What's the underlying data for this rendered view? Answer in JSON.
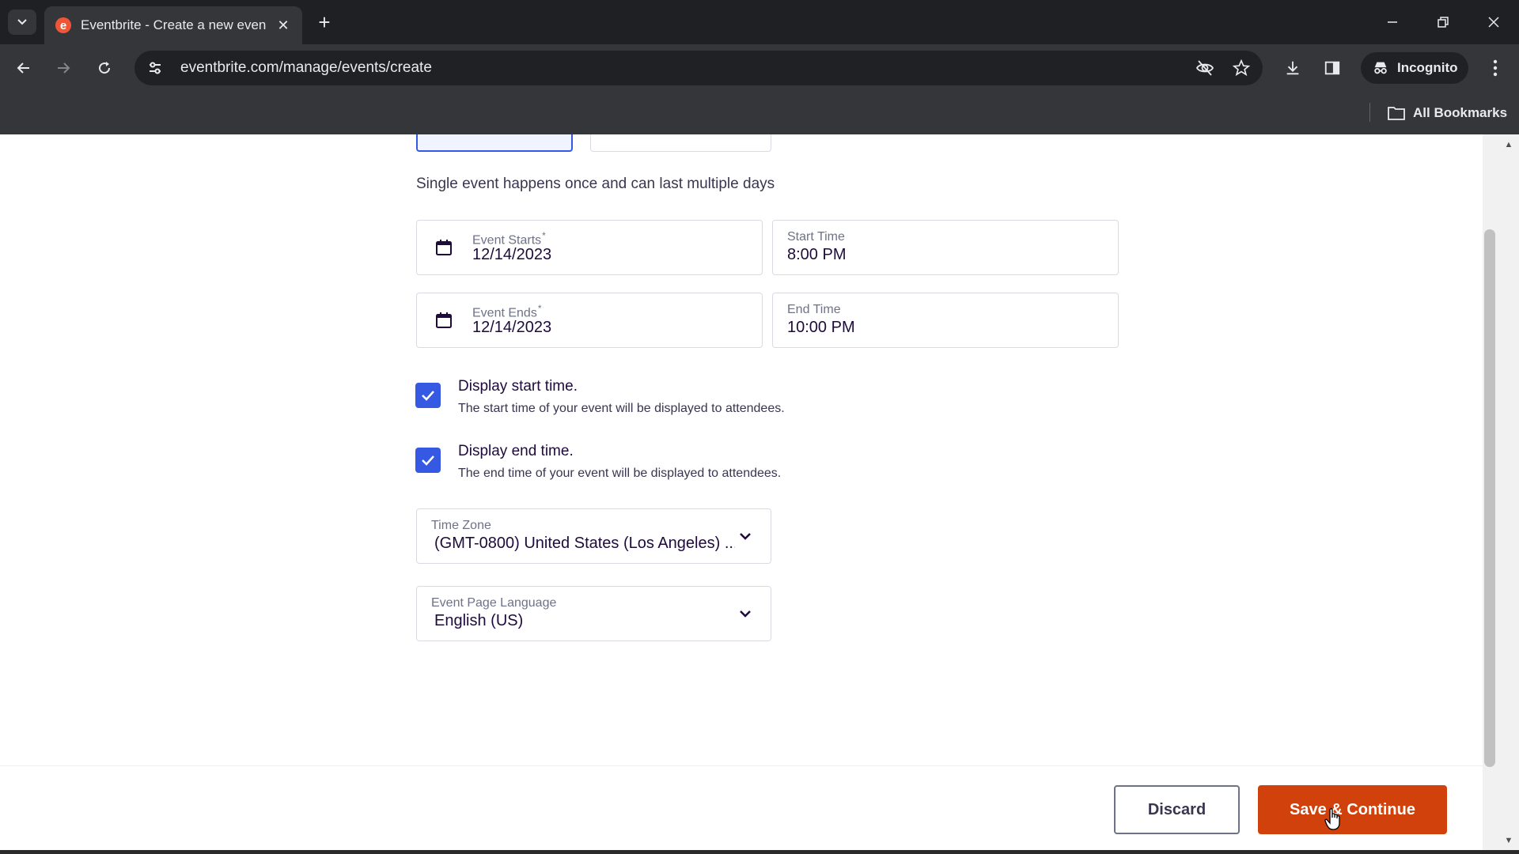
{
  "browser": {
    "tab_title": "Eventbrite - Create a new even",
    "url": "eventbrite.com/manage/events/create",
    "incognito_label": "Incognito",
    "all_bookmarks_label": "All Bookmarks",
    "favicon_letter": "e",
    "accent_color": "#f05537"
  },
  "form": {
    "helper_text": "Single event happens once and can last multiple days",
    "event_starts": {
      "label": "Event Starts",
      "required_mark": "*",
      "value": "12/14/2023"
    },
    "start_time": {
      "label": "Start Time",
      "value": "8:00 PM"
    },
    "event_ends": {
      "label": "Event Ends",
      "required_mark": "*",
      "value": "12/14/2023"
    },
    "end_time": {
      "label": "End Time",
      "value": "10:00 PM"
    },
    "display_start": {
      "checked": true,
      "title": "Display start time.",
      "description": "The start time of your event will be displayed to attendees."
    },
    "display_end": {
      "checked": true,
      "title": "Display end time.",
      "description": "The end time of your event will be displayed to attendees."
    },
    "time_zone": {
      "label": "Time Zone",
      "value": "(GMT-0800) United States (Los Angeles) ..."
    },
    "language": {
      "label": "Event Page Language",
      "value": "English (US)"
    },
    "checkbox_color": "#3659e3"
  },
  "footer": {
    "discard_label": "Discard",
    "save_label": "Save & Continue",
    "save_color": "#d1410c"
  }
}
